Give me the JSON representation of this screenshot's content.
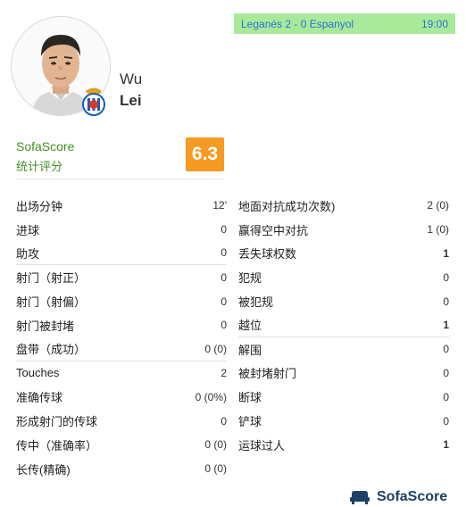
{
  "player": {
    "first_name": "Wu",
    "last_name": "Lei"
  },
  "match": {
    "score_text": "Leganés 2 - 0 Espanyol",
    "time": "19:00"
  },
  "rating": {
    "brand": "SofaScore",
    "label": "统计评分",
    "value": "6.3",
    "color": "#f59a22"
  },
  "left_stats": [
    {
      "label": "出场分钟",
      "value": "12'"
    },
    {
      "label": "进球",
      "value": "0"
    },
    {
      "label": "助攻",
      "value": "0"
    },
    {
      "label": "射门（射正）",
      "value": "0"
    },
    {
      "label": "射门（射偏）",
      "value": "0"
    },
    {
      "label": "射门被封堵",
      "value": "0"
    },
    {
      "label": "盘带（成功）",
      "value": "0 (0)"
    },
    {
      "label": "Touches",
      "value": "2"
    },
    {
      "label": "准确传球",
      "value": "0 (0%)"
    },
    {
      "label": "形成射门的传球",
      "value": "0"
    },
    {
      "label": "传中（准确率）",
      "value": "0 (0)"
    },
    {
      "label": "长传(精确)",
      "value": "0 (0)"
    }
  ],
  "right_stats": [
    {
      "label": "地面对抗成功次数)",
      "value": "2 (0)"
    },
    {
      "label": "赢得空中对抗",
      "value": "1 (0)"
    },
    {
      "label": "丢失球权数",
      "value": "1"
    },
    {
      "label": "犯规",
      "value": "0"
    },
    {
      "label": "被犯规",
      "value": "0"
    },
    {
      "label": "越位",
      "value": "1"
    },
    {
      "label": "解围",
      "value": "0"
    },
    {
      "label": "被封堵射门",
      "value": "0"
    },
    {
      "label": "断球",
      "value": "0"
    },
    {
      "label": "铲球",
      "value": "0"
    },
    {
      "label": "运球过人",
      "value": "1"
    }
  ],
  "footer": {
    "brand": "SofaScore",
    "icon": "sofascore-logo-icon"
  },
  "colors": {
    "banner_bg": "#a9ea9a",
    "banner_text": "#2f6fd6",
    "brand_green": "#3f8f24"
  }
}
